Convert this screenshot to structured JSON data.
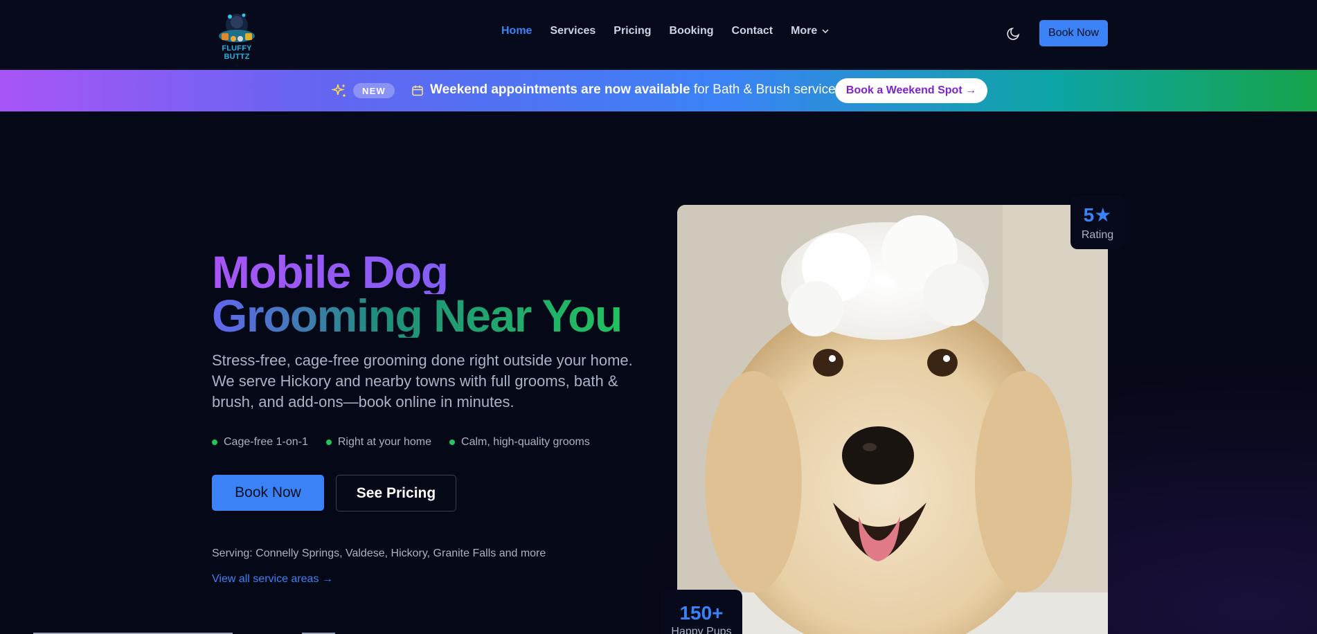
{
  "brand": {
    "name": "FLUFFY BUTTZ"
  },
  "nav": {
    "links": [
      {
        "label": "Home",
        "active": true
      },
      {
        "label": "Services"
      },
      {
        "label": "Pricing"
      },
      {
        "label": "Booking"
      },
      {
        "label": "Contact"
      }
    ],
    "more_label": "More",
    "cta_label": "Book Now",
    "theme_icon": "moon-icon"
  },
  "banner": {
    "badge": "NEW",
    "text_bold": "Weekend appointments are now available",
    "text_rest": " for Bath & Brush services!",
    "cta_label": "Book a Weekend Spot →"
  },
  "hero": {
    "title_line1": "Mobile Dog",
    "title_line2": "Grooming Near You",
    "subtitle": "Stress-free, cage-free grooming done right outside your home. We serve Hickory and nearby towns with full grooms, bath & brush, and add-ons—book online in minutes.",
    "features": [
      "Cage-free 1-on-1",
      "Right at your home",
      "Calm, high-quality grooms"
    ],
    "primary_cta": "Book Now",
    "secondary_cta": "See Pricing",
    "serving": "Serving: Connelly Springs, Valdese, Hickory, Granite Falls and more",
    "areas_link": "View all service areas →"
  },
  "stats": {
    "rating_value": "5★",
    "rating_label": "Rating",
    "pups_value": "150+",
    "pups_label": "Happy Pups"
  },
  "colors": {
    "accent": "#3b82f6",
    "feature_dot": "#22c55e",
    "background": "#050816"
  }
}
